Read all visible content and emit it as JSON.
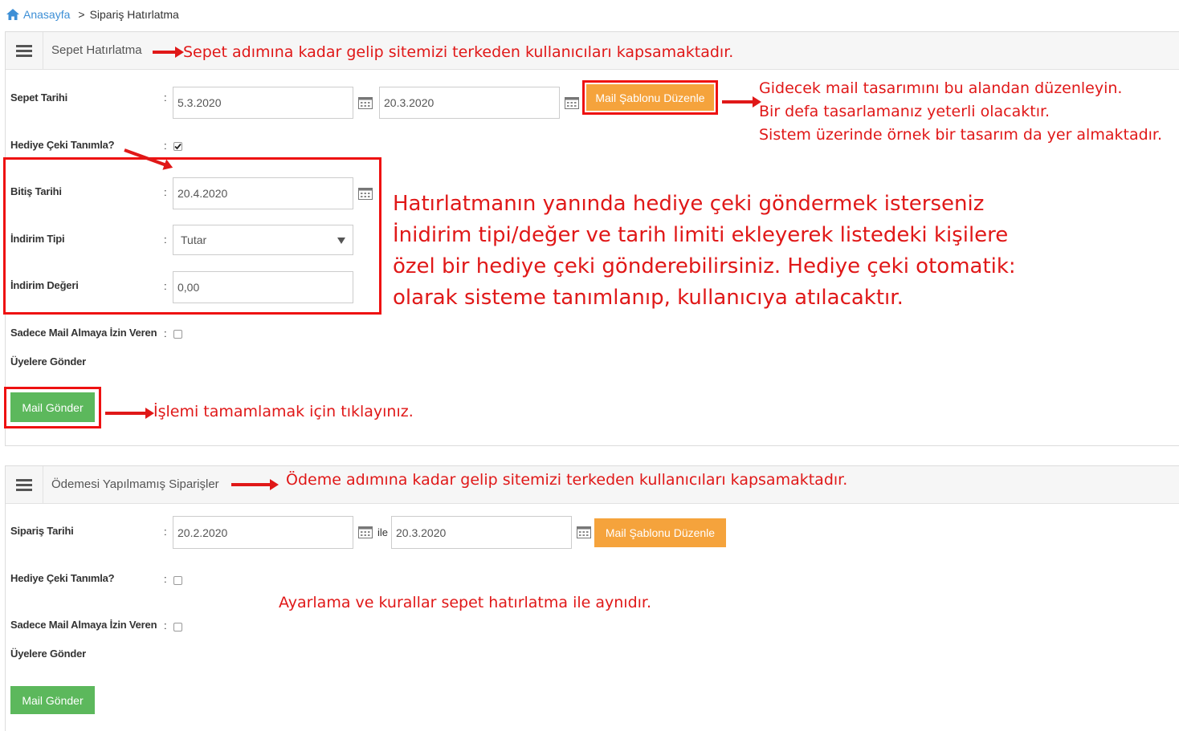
{
  "breadcrumb": {
    "home": "Anasayfa",
    "separator": ">",
    "current": "Sipariş Hatırlatma"
  },
  "panel1": {
    "title": "Sepet Hatırlatma",
    "sepet_tarihi_label": "Sepet Tarihi",
    "start_date": "5.3.2020",
    "end_date": "20.3.2020",
    "template_button": "Mail Şablonu Düzenle",
    "hediye_label": "Hediye Çeki Tanımla?",
    "bitis_label": "Bitiş Tarihi",
    "bitis_value": "20.4.2020",
    "indirim_tipi_label": "İndirim Tipi",
    "indirim_tipi_value": "Tutar",
    "indirim_degeri_label": "İndirim Değeri",
    "indirim_degeri_value": "0,00",
    "sadece_label_1": "Sadece Mail Almaya İzin Veren",
    "sadece_label_2": "Üyelere Gönder",
    "send_button": "Mail Gönder"
  },
  "panel2": {
    "title": "Ödemesi Yapılmamış Siparişler",
    "siparis_tarihi_label": "Sipariş Tarihi",
    "start_date": "20.2.2020",
    "between": "ile",
    "end_date": "20.3.2020",
    "template_button": "Mail Şablonu Düzenle",
    "hediye_label": "Hediye Çeki Tanımla?",
    "sadece_label_1": "Sadece Mail Almaya İzin Veren",
    "sadece_label_2": "Üyelere Gönder",
    "send_button": "Mail Gönder"
  },
  "colon": ":",
  "annotations": {
    "sepet": "Sepet adımına kadar gelip sitemizi terkeden kullanıcıları kapsamaktadır.",
    "template_1": "Gidecek mail tasarımını bu alandan düzenleyin.",
    "template_2": "Bir defa tasarlamanız yeterli olacaktır.",
    "template_3": "Sistem üzerinde örnek bir tasarım da yer almaktadır.",
    "gift_1": "Hatırlatmanın yanında hediye çeki göndermek isterseniz",
    "gift_2": "İnidirim tipi/değer ve tarih limiti ekleyerek listedeki kişilere",
    "gift_3": "özel bir hediye çeki gönderebilirsiniz. Hediye çeki otomatik:",
    "gift_4": "olarak sisteme tanımlanıp, kullanıcıya atılacaktır.",
    "send": "İşlemi tamamlamak için tıklayınız.",
    "odeme": "Ödeme adımına kadar gelip sitemizi terkeden kullanıcıları kapsamaktadır.",
    "same": "Ayarlama ve kurallar sepet hatırlatma ile aynıdır."
  },
  "colors": {
    "accent_red": "#e01818",
    "orange": "#f5a33c",
    "green": "#5cb85c",
    "link": "#3d8fd6"
  },
  "icons": [
    "home-icon",
    "menu-icon",
    "calendar-icon",
    "dropdown-arrow-icon",
    "checkbox-icon",
    "arrow-icon"
  ],
  "state": {
    "panel1_hediye_checked": true,
    "panel1_sadece_checked": false,
    "panel2_hediye_checked": false,
    "panel2_sadece_checked": false
  }
}
